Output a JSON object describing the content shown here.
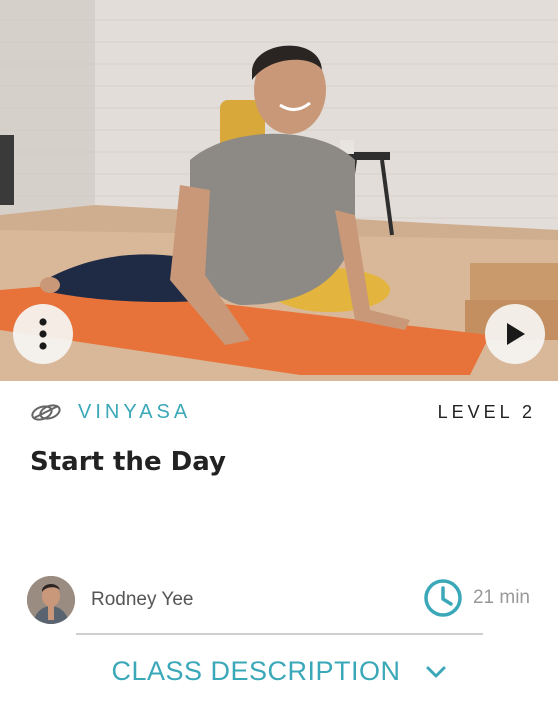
{
  "card": {
    "style_label": "VINYASA",
    "level_label": "LEVEL 2",
    "title": "Start the Day",
    "instructor_name": "Rodney Yee",
    "duration": "21 min",
    "description_toggle": "CLASS DESCRIPTION"
  },
  "icons": {
    "more": "more-vertical-icon",
    "play": "play-icon",
    "style": "yoga-style-icon",
    "duration": "clock-icon",
    "expand": "chevron-down-icon"
  },
  "colors": {
    "accent": "#3aa8b8",
    "title": "#222222",
    "muted": "#999999",
    "mat": "#e8733a"
  }
}
